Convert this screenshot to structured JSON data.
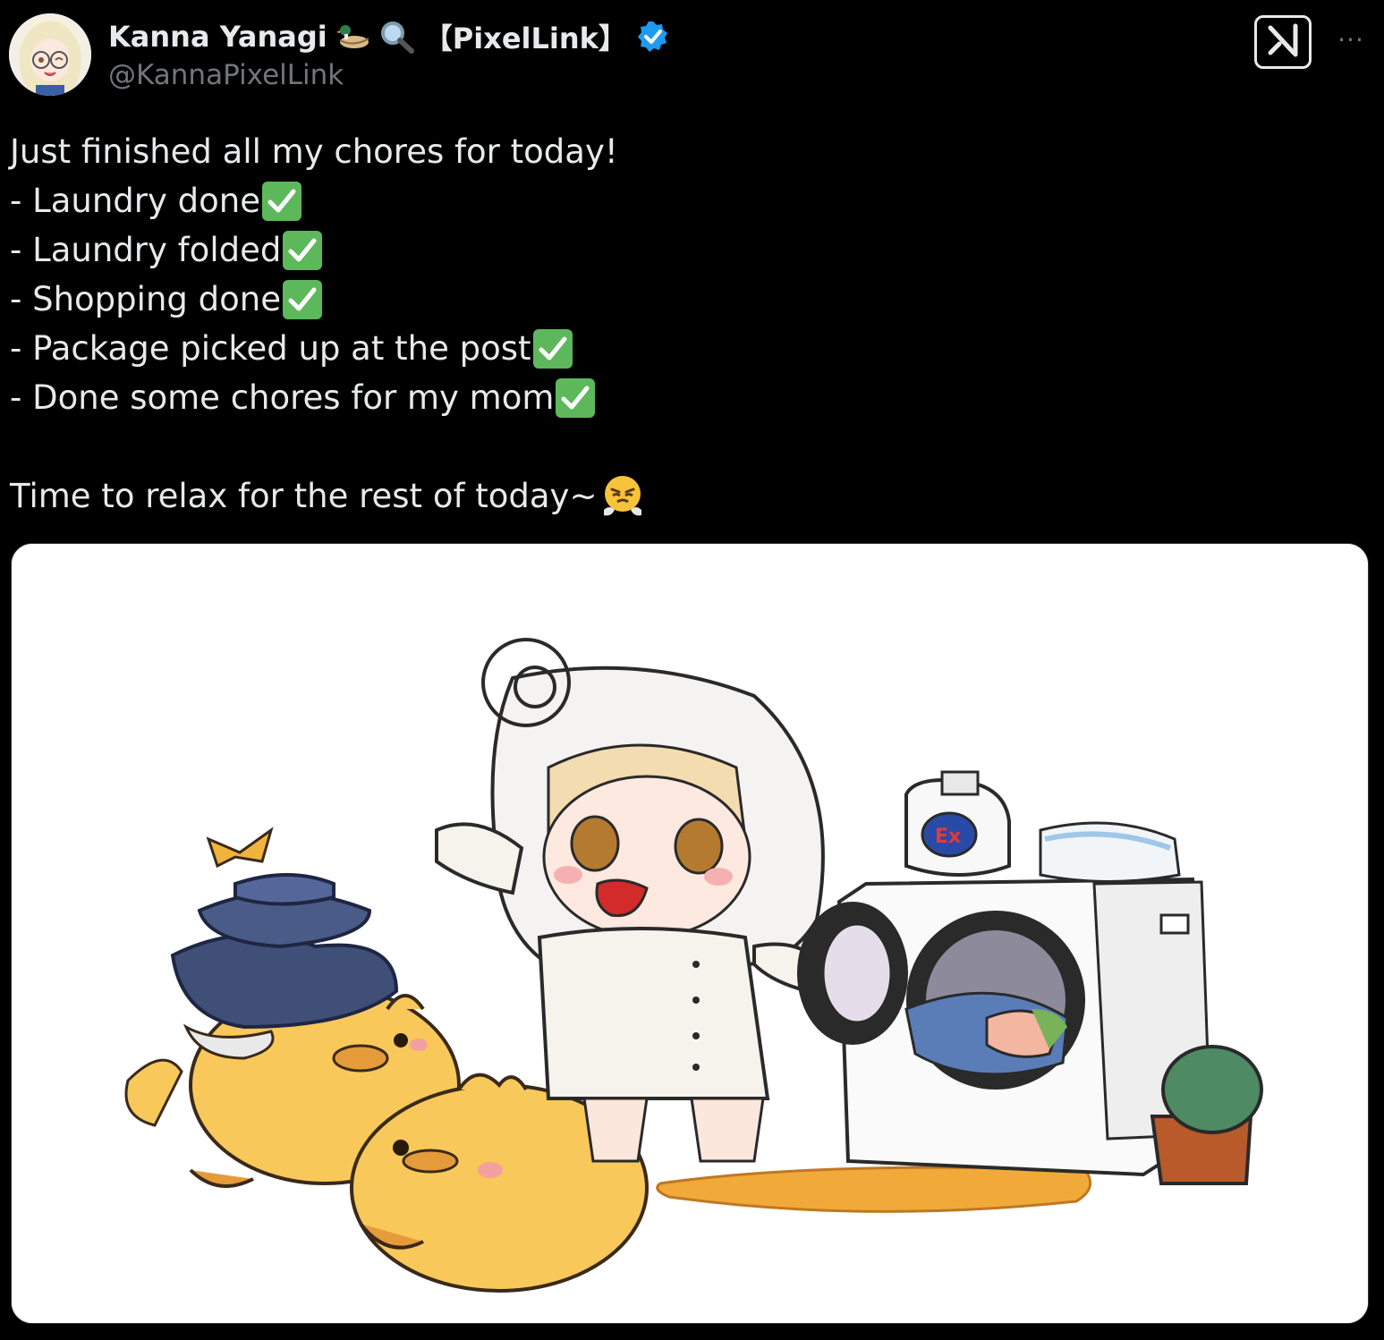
{
  "author": {
    "display_name": "Kanna Yanagi",
    "affiliation": "【PixelLink】",
    "handle": "@KannaPixelLink",
    "verified": true,
    "name_emojis": [
      "duck-icon",
      "magnifier-icon"
    ]
  },
  "header_actions": {
    "grok_icon": "grok-icon",
    "more_label": "···"
  },
  "post": {
    "intro": "Just finished all my chores for today!",
    "items": [
      "- Laundry done",
      "- Laundry folded",
      "- Shopping done",
      "- Package picked up at the post",
      "- Done some chores for my mom"
    ],
    "outro": "Time to relax for the rest of today~",
    "outro_emoji": "face-with-steam-icon"
  },
  "colors": {
    "background": "#000000",
    "text": "#e7e9ea",
    "muted": "#71767b",
    "verified_blue": "#1d9bf0",
    "check_green": "#5db85c"
  }
}
